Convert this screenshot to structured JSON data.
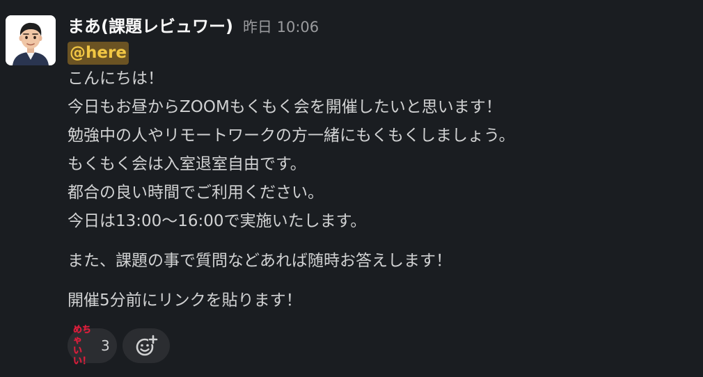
{
  "message": {
    "author": "まあ(課題レビュワー)",
    "timestamp": "昨日 10:06",
    "mention": "@here",
    "lines": [
      "こんにちは！",
      "今日もお昼からZOOMもくもく会を開催したいと思います！",
      "勉強中の人やリモートワークの方一緒にもくもくしましょう。",
      "もくもく会は入室退室自由です。",
      "都合の良い時間でご利用ください。",
      "今日は13:00〜16:00で実施いたします。"
    ],
    "paragraph2": "また、課題の事で質問などあれば随時お答えします！",
    "paragraph3": "開催5分前にリンクを貼ります！"
  },
  "reactions": [
    {
      "emoji_text_line1": "めちゃ",
      "emoji_text_line2": "いい！",
      "count": "3"
    }
  ],
  "icons": {
    "avatar": "memoji-avatar",
    "add_reaction": "add-reaction-icon"
  },
  "colors": {
    "background": "#1a1d21",
    "mention_bg": "#6b5323",
    "mention_text": "#f2c744",
    "reaction_text": "#e01e3c"
  }
}
